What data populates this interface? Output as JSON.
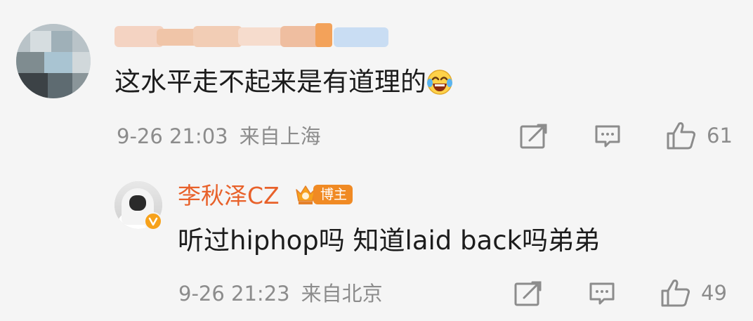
{
  "comment": {
    "text": "这水平走不起来是有道理的",
    "emoji_icon": "laughing-crying-emoji-icon",
    "time": "9-26 21:03",
    "location": "来自上海",
    "like_count": "61"
  },
  "reply": {
    "username": "李秋泽CZ",
    "badge_label": "博主",
    "text": "听过hiphop吗 知道laid back吗弟弟",
    "time": "9-26 21:23",
    "location": "来自北京",
    "like_count": "49"
  },
  "colors": {
    "background": "#f5f5f5",
    "username_accent": "#e8612a",
    "meta_gray": "#8c8c8c",
    "badge_orange": "#f08a24",
    "verified_gold": "#f7a21b"
  },
  "icons": [
    "share-icon",
    "comment-icon",
    "like-icon",
    "crown-icon",
    "verified-icon"
  ]
}
